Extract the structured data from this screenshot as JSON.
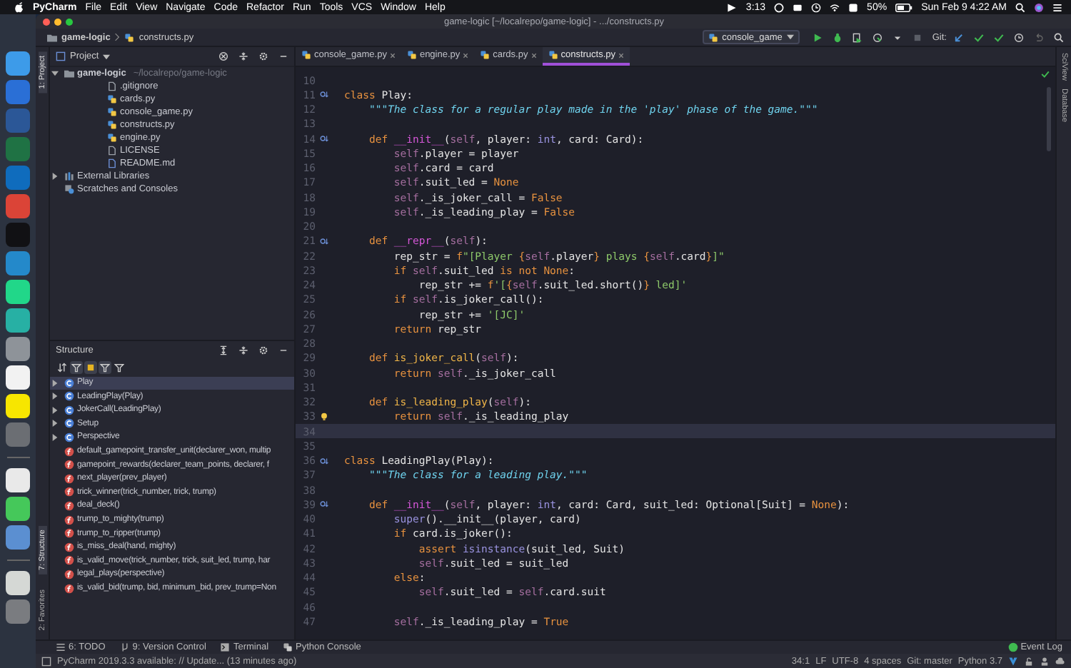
{
  "menu_bar": {
    "app": "PyCharm",
    "menus": [
      "File",
      "Edit",
      "View",
      "Navigate",
      "Code",
      "Refactor",
      "Run",
      "Tools",
      "VCS",
      "Window",
      "Help"
    ],
    "timer": "3:13",
    "battery": "50%",
    "clock": "Sun Feb 9  4:22 AM"
  },
  "dock": [
    {
      "kind": "app",
      "color": "#3d9be9"
    },
    {
      "kind": "app",
      "color": "#2a6fd6"
    },
    {
      "kind": "app",
      "color": "#2b5797"
    },
    {
      "kind": "app",
      "color": "#1f7244"
    },
    {
      "kind": "app",
      "color": "#0f6cbd"
    },
    {
      "kind": "app",
      "color": "#db4437"
    },
    {
      "kind": "app",
      "color": "#111114"
    },
    {
      "kind": "app",
      "color": "#2489ca"
    },
    {
      "kind": "app",
      "color": "#21d789"
    },
    {
      "kind": "app",
      "color": "#27b0a4"
    },
    {
      "kind": "app",
      "color": "#8e9399"
    },
    {
      "kind": "app",
      "color": "#f2f2f2"
    },
    {
      "kind": "app",
      "color": "#f7e600"
    },
    {
      "kind": "app",
      "color": "#6b6e73"
    },
    {
      "kind": "separator"
    },
    {
      "kind": "app",
      "color": "#e9e9e9"
    },
    {
      "kind": "app",
      "color": "#45c85a"
    },
    {
      "kind": "app",
      "color": "#5b8fd1"
    },
    {
      "kind": "separator"
    },
    {
      "kind": "app",
      "color": "#d5d8d5"
    },
    {
      "kind": "app",
      "color": "#7a7c80"
    }
  ],
  "window": {
    "title": "game-logic [~/localrepo/game-logic] - .../constructs.py"
  },
  "breadcrumbs": [
    {
      "kind": "folder",
      "label": "game-logic"
    },
    {
      "kind": "python",
      "label": "constructs.py"
    }
  ],
  "run_config": "console_game",
  "vcs_label": "Git:",
  "left_strip": {
    "top": [
      {
        "label": "1: Project",
        "selected": true
      }
    ],
    "bottom": [
      {
        "label": "7: Structure",
        "selected": true
      },
      {
        "label": "2: Favorites",
        "selected": false
      }
    ]
  },
  "project": {
    "title": "Project",
    "tree": [
      {
        "kind": "folder",
        "label": "game-logic",
        "path": "~/localrepo/game-logic",
        "expanded": true,
        "children": [
          {
            "kind": "ignore",
            "label": ".gitignore"
          },
          {
            "kind": "python",
            "label": "cards.py"
          },
          {
            "kind": "python",
            "label": "console_game.py"
          },
          {
            "kind": "python",
            "label": "constructs.py"
          },
          {
            "kind": "python",
            "label": "engine.py"
          },
          {
            "kind": "text",
            "label": "LICENSE"
          },
          {
            "kind": "markdown",
            "label": "README.md"
          }
        ]
      },
      {
        "kind": "library",
        "label": "External Libraries",
        "expanded": false
      },
      {
        "kind": "scratch",
        "label": "Scratches and Consoles"
      }
    ]
  },
  "structure": {
    "title": "Structure",
    "toolbar": [
      {
        "on": false
      },
      {
        "on": true
      },
      {
        "on": true
      },
      {
        "on": true
      },
      {
        "on": false
      }
    ],
    "items": [
      {
        "kind": "class",
        "label": "Play",
        "selected": true
      },
      {
        "kind": "class",
        "label": "LeadingPlay(Play)",
        "selected": false
      },
      {
        "kind": "class",
        "label": "JokerCall(LeadingPlay)",
        "selected": false
      },
      {
        "kind": "class",
        "label": "Setup",
        "selected": false
      },
      {
        "kind": "class",
        "label": "Perspective",
        "selected": false
      },
      {
        "kind": "function",
        "label": "default_gamepoint_transfer_unit(declarer_won, multip",
        "selected": false
      },
      {
        "kind": "function",
        "label": "gamepoint_rewards(declarer_team_points, declarer, f",
        "selected": false
      },
      {
        "kind": "function",
        "label": "next_player(prev_player)",
        "selected": false
      },
      {
        "kind": "function",
        "label": "trick_winner(trick_number, trick, trump)",
        "selected": false
      },
      {
        "kind": "function",
        "label": "deal_deck()",
        "selected": false
      },
      {
        "kind": "function",
        "label": "trump_to_mighty(trump)",
        "selected": false
      },
      {
        "kind": "function",
        "label": "trump_to_ripper(trump)",
        "selected": false
      },
      {
        "kind": "function",
        "label": "is_miss_deal(hand, mighty)",
        "selected": false
      },
      {
        "kind": "function",
        "label": "is_valid_move(trick_number, trick, suit_led, trump, har",
        "selected": false
      },
      {
        "kind": "function",
        "label": "legal_plays(perspective)",
        "selected": false
      },
      {
        "kind": "function",
        "label": "is_valid_bid(trump, bid, minimum_bid, prev_trump=Non",
        "selected": false
      }
    ]
  },
  "tabs": [
    {
      "label": "console_game.py",
      "selected": false
    },
    {
      "label": "engine.py",
      "selected": false
    },
    {
      "label": "cards.py",
      "selected": false
    },
    {
      "label": "constructs.py",
      "selected": true
    }
  ],
  "editor": {
    "lines": [
      {
        "n": "10",
        "kind": "plain",
        "current": false
      },
      {
        "n": "11",
        "kind": "override",
        "current": false,
        "t": [
          {
            "kind": "keyword",
            "text": "class "
          },
          {
            "kind": "plain",
            "text": "Play:"
          }
        ]
      },
      {
        "n": "12",
        "kind": "plain",
        "current": false,
        "t": [
          {
            "kind": "docstring",
            "text": "    \"\"\"The class for a regular play made in the 'play' phase of the game.\"\"\""
          }
        ]
      },
      {
        "n": "13",
        "kind": "plain",
        "current": false
      },
      {
        "n": "14",
        "kind": "override",
        "current": false,
        "t": [
          {
            "kind": "keyword",
            "text": "    def "
          },
          {
            "kind": "magic",
            "text": "__init__"
          },
          {
            "kind": "plain",
            "text": "("
          },
          {
            "kind": "self",
            "text": "self"
          },
          {
            "kind": "plain",
            "text": ", player: "
          },
          {
            "kind": "builtin",
            "text": "int"
          },
          {
            "kind": "plain",
            "text": ", card: Card):"
          }
        ]
      },
      {
        "n": "15",
        "kind": "plain",
        "current": false,
        "t": [
          {
            "kind": "self",
            "text": "        self"
          },
          {
            "kind": "plain",
            "text": ".player = player"
          }
        ]
      },
      {
        "n": "16",
        "kind": "plain",
        "current": false,
        "t": [
          {
            "kind": "self",
            "text": "        self"
          },
          {
            "kind": "plain",
            "text": ".card = card"
          }
        ]
      },
      {
        "n": "17",
        "kind": "plain",
        "current": false,
        "t": [
          {
            "kind": "self",
            "text": "        self"
          },
          {
            "kind": "plain",
            "text": ".suit_led = "
          },
          {
            "kind": "keyword",
            "text": "None"
          }
        ]
      },
      {
        "n": "18",
        "kind": "plain",
        "current": false,
        "t": [
          {
            "kind": "self",
            "text": "        self"
          },
          {
            "kind": "plain",
            "text": "._is_joker_call = "
          },
          {
            "kind": "keyword",
            "text": "False"
          }
        ]
      },
      {
        "n": "19",
        "kind": "plain",
        "current": false,
        "t": [
          {
            "kind": "self",
            "text": "        self"
          },
          {
            "kind": "plain",
            "text": "._is_leading_play = "
          },
          {
            "kind": "keyword",
            "text": "False"
          }
        ]
      },
      {
        "n": "20",
        "kind": "plain",
        "current": false
      },
      {
        "n": "21",
        "kind": "override",
        "current": false,
        "t": [
          {
            "kind": "keyword",
            "text": "    def "
          },
          {
            "kind": "magic",
            "text": "__repr__"
          },
          {
            "kind": "plain",
            "text": "("
          },
          {
            "kind": "self",
            "text": "self"
          },
          {
            "kind": "plain",
            "text": "):"
          }
        ]
      },
      {
        "n": "22",
        "kind": "plain",
        "current": false,
        "t": [
          {
            "kind": "plain",
            "text": "        rep_str = "
          },
          {
            "kind": "keyword",
            "text": "f"
          },
          {
            "kind": "string",
            "text": "\"[Player "
          },
          {
            "kind": "keyword",
            "text": "{"
          },
          {
            "kind": "self",
            "text": "self"
          },
          {
            "kind": "plain",
            "text": ".player"
          },
          {
            "kind": "keyword",
            "text": "}"
          },
          {
            "kind": "string",
            "text": " plays "
          },
          {
            "kind": "keyword",
            "text": "{"
          },
          {
            "kind": "self",
            "text": "self"
          },
          {
            "kind": "plain",
            "text": ".card"
          },
          {
            "kind": "keyword",
            "text": "}"
          },
          {
            "kind": "string",
            "text": "]\""
          }
        ]
      },
      {
        "n": "23",
        "kind": "plain",
        "current": false,
        "t": [
          {
            "kind": "keyword",
            "text": "        if "
          },
          {
            "kind": "self",
            "text": "self"
          },
          {
            "kind": "plain",
            "text": ".suit_led "
          },
          {
            "kind": "keyword",
            "text": "is not None"
          },
          {
            "kind": "plain",
            "text": ":"
          }
        ]
      },
      {
        "n": "24",
        "kind": "plain",
        "current": false,
        "t": [
          {
            "kind": "plain",
            "text": "            rep_str += "
          },
          {
            "kind": "keyword",
            "text": "f"
          },
          {
            "kind": "string",
            "text": "'["
          },
          {
            "kind": "keyword",
            "text": "{"
          },
          {
            "kind": "self",
            "text": "self"
          },
          {
            "kind": "plain",
            "text": ".suit_led.short()"
          },
          {
            "kind": "keyword",
            "text": "}"
          },
          {
            "kind": "string",
            "text": " led]'"
          }
        ]
      },
      {
        "n": "25",
        "kind": "plain",
        "current": false,
        "t": [
          {
            "kind": "keyword",
            "text": "        if "
          },
          {
            "kind": "self",
            "text": "self"
          },
          {
            "kind": "plain",
            "text": ".is_joker_call():"
          }
        ]
      },
      {
        "n": "26",
        "kind": "plain",
        "current": false,
        "t": [
          {
            "kind": "plain",
            "text": "            rep_str += "
          },
          {
            "kind": "string",
            "text": "'[JC]'"
          }
        ]
      },
      {
        "n": "27",
        "kind": "plain",
        "current": false,
        "t": [
          {
            "kind": "keyword",
            "text": "        return "
          },
          {
            "kind": "plain",
            "text": "rep_str"
          }
        ]
      },
      {
        "n": "28",
        "kind": "plain",
        "current": false
      },
      {
        "n": "29",
        "kind": "plain",
        "current": false,
        "t": [
          {
            "kind": "keyword",
            "text": "    def "
          },
          {
            "kind": "function",
            "text": "is_joker_call"
          },
          {
            "kind": "plain",
            "text": "("
          },
          {
            "kind": "self",
            "text": "self"
          },
          {
            "kind": "plain",
            "text": "):"
          }
        ]
      },
      {
        "n": "30",
        "kind": "plain",
        "current": false,
        "t": [
          {
            "kind": "keyword",
            "text": "        return "
          },
          {
            "kind": "self",
            "text": "self"
          },
          {
            "kind": "plain",
            "text": "._is_joker_call"
          }
        ]
      },
      {
        "n": "31",
        "kind": "plain",
        "current": false
      },
      {
        "n": "32",
        "kind": "plain",
        "current": false,
        "t": [
          {
            "kind": "keyword",
            "text": "    def "
          },
          {
            "kind": "function",
            "text": "is_leading_play"
          },
          {
            "kind": "plain",
            "text": "("
          },
          {
            "kind": "self",
            "text": "self"
          },
          {
            "kind": "plain",
            "text": "):"
          }
        ]
      },
      {
        "n": "33",
        "kind": "bulb",
        "current": false,
        "t": [
          {
            "kind": "keyword",
            "text": "        return "
          },
          {
            "kind": "self",
            "text": "self"
          },
          {
            "kind": "plain",
            "text": "._is_leading_play"
          }
        ]
      },
      {
        "n": "34",
        "kind": "plain",
        "current": true
      },
      {
        "n": "35",
        "kind": "plain",
        "current": false
      },
      {
        "n": "36",
        "kind": "override",
        "current": false,
        "t": [
          {
            "kind": "keyword",
            "text": "class "
          },
          {
            "kind": "plain",
            "text": "LeadingPlay(Play):"
          }
        ]
      },
      {
        "n": "37",
        "kind": "plain",
        "current": false,
        "t": [
          {
            "kind": "docstring",
            "text": "    \"\"\"The class for a leading play.\"\"\""
          }
        ]
      },
      {
        "n": "38",
        "kind": "plain",
        "current": false
      },
      {
        "n": "39",
        "kind": "override",
        "current": false,
        "t": [
          {
            "kind": "keyword",
            "text": "    def "
          },
          {
            "kind": "magic",
            "text": "__init__"
          },
          {
            "kind": "plain",
            "text": "("
          },
          {
            "kind": "self",
            "text": "self"
          },
          {
            "kind": "plain",
            "text": ", player: "
          },
          {
            "kind": "builtin",
            "text": "int"
          },
          {
            "kind": "plain",
            "text": ", card: Card, suit_led: Optional[Suit] = "
          },
          {
            "kind": "keyword",
            "text": "None"
          },
          {
            "kind": "plain",
            "text": "):"
          }
        ]
      },
      {
        "n": "40",
        "kind": "plain",
        "current": false,
        "t": [
          {
            "kind": "builtin",
            "text": "        super"
          },
          {
            "kind": "plain",
            "text": "().__init__(player, card)"
          }
        ]
      },
      {
        "n": "41",
        "kind": "plain",
        "current": false,
        "t": [
          {
            "kind": "keyword",
            "text": "        if "
          },
          {
            "kind": "plain",
            "text": "card.is_joker():"
          }
        ]
      },
      {
        "n": "42",
        "kind": "plain",
        "current": false,
        "t": [
          {
            "kind": "keyword",
            "text": "            assert "
          },
          {
            "kind": "builtin",
            "text": "isinstance"
          },
          {
            "kind": "plain",
            "text": "(suit_led, Suit)"
          }
        ]
      },
      {
        "n": "43",
        "kind": "plain",
        "current": false,
        "t": [
          {
            "kind": "self",
            "text": "            self"
          },
          {
            "kind": "plain",
            "text": ".suit_led = suit_led"
          }
        ]
      },
      {
        "n": "44",
        "kind": "plain",
        "current": false,
        "t": [
          {
            "kind": "keyword",
            "text": "        else"
          },
          {
            "kind": "plain",
            "text": ":"
          }
        ]
      },
      {
        "n": "45",
        "kind": "plain",
        "current": false,
        "t": [
          {
            "kind": "self",
            "text": "            self"
          },
          {
            "kind": "plain",
            "text": ".suit_led = "
          },
          {
            "kind": "self",
            "text": "self"
          },
          {
            "kind": "plain",
            "text": ".card.suit"
          }
        ]
      },
      {
        "n": "46",
        "kind": "plain",
        "current": false
      },
      {
        "n": "47",
        "kind": "plain",
        "current": false,
        "t": [
          {
            "kind": "self",
            "text": "        self"
          },
          {
            "kind": "plain",
            "text": "._is_leading_play = "
          },
          {
            "kind": "keyword",
            "text": "True"
          }
        ]
      }
    ]
  },
  "right_strip": [
    "SciView",
    "Database"
  ],
  "tool_tabs": [
    {
      "kind": "todo",
      "label": "6: TODO"
    },
    {
      "kind": "vcs",
      "label": "9: Version Control"
    },
    {
      "kind": "terminal",
      "label": "Terminal"
    },
    {
      "kind": "console",
      "label": "Python Console"
    }
  ],
  "event_log": "Event Log",
  "status_bar": {
    "message": "PyCharm 2019.3.3 available: // Update... (13 minutes ago)",
    "items": [
      "34:1",
      "LF",
      "UTF-8",
      "4 spaces",
      "Git: master",
      "Python 3.7"
    ]
  }
}
